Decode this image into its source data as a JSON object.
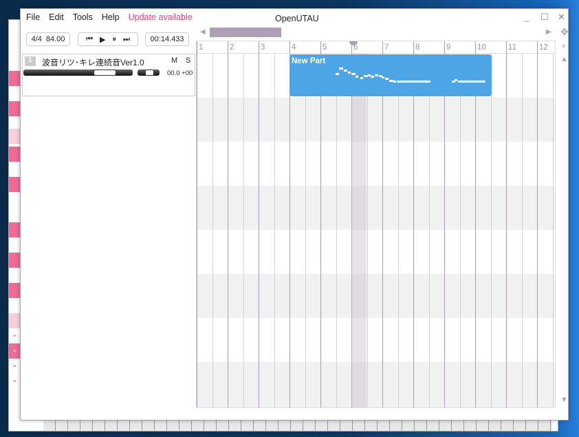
{
  "window": {
    "title": "OpenUTAU",
    "minimize": "_",
    "maximize": "☐",
    "close": "✕"
  },
  "menu": [
    {
      "label": "File"
    },
    {
      "label": "Edit"
    },
    {
      "label": "Tools"
    },
    {
      "label": "Help"
    }
  ],
  "update": "Update available",
  "toolbar": {
    "time_signature": "4/4",
    "bpm": "84.00",
    "timecode": "00:14.433"
  },
  "track": {
    "number": "1",
    "name": "波音リツ･キレ連続音Ver1.0",
    "mute": "M",
    "solo": "S",
    "volume": "00.0",
    "pan": "+00"
  },
  "bars": [
    "1",
    "2",
    "3",
    "4",
    "5",
    "6",
    "7",
    "8",
    "9",
    "10",
    "11",
    "12"
  ],
  "part": {
    "name": "New Part",
    "color": "#4ea5e6"
  },
  "colors": {
    "accent": "#e8407a",
    "scrollbar": "#aea0b4"
  }
}
